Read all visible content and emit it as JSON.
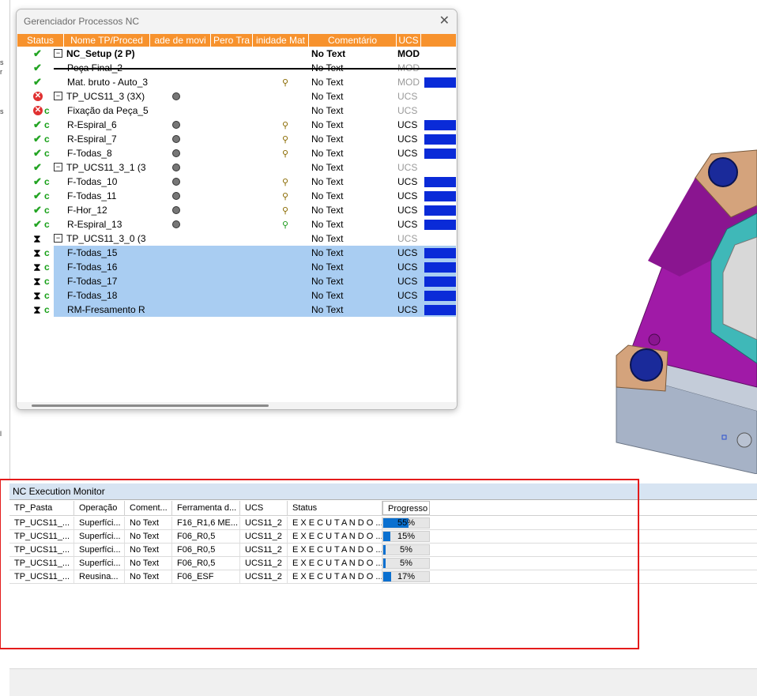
{
  "left_strip_fragments": [
    "s",
    "r",
    "s",
    "l"
  ],
  "nc_manager": {
    "title": "Gerenciador Processos NC",
    "close_label": "✕",
    "columns": [
      "Status",
      "Nome TP/Proced",
      "ade de movi",
      "Pero Tra",
      "inidade Mat",
      "Comentário",
      "UCS"
    ],
    "rows": [
      {
        "status": "setup",
        "c": false,
        "expand": true,
        "name": "NC_Setup (2 P)",
        "bold": true,
        "bulb": false,
        "mat": "",
        "comment": "No Text",
        "ucs": "MOD",
        "ucs_style": "bold",
        "bar": false,
        "sel": false,
        "indent": 0
      },
      {
        "status": "check",
        "c": false,
        "expand": false,
        "name": "Peça Final_2",
        "bold": false,
        "bulb": false,
        "mat": "",
        "comment": "No Text",
        "ucs": "MOD",
        "ucs_style": "gray",
        "bar": false,
        "sel": false,
        "indent": 1
      },
      {
        "status": "check",
        "c": false,
        "expand": false,
        "name": "Mat. bruto - Auto_3",
        "bold": false,
        "bulb": false,
        "mat": "normal",
        "comment": "No Text",
        "ucs": "MOD",
        "ucs_style": "gray",
        "bar": true,
        "sel": false,
        "indent": 1
      },
      {
        "status": "err",
        "c": false,
        "expand": true,
        "name": "TP_UCS11_3 (3X)",
        "bold": false,
        "bulb": true,
        "mat": "",
        "comment": "No Text",
        "ucs": "UCS",
        "ucs_style": "gray",
        "bar": false,
        "sel": false,
        "indent": 0
      },
      {
        "status": "err",
        "c": true,
        "expand": false,
        "name": "Fixação da Peça_5",
        "bold": false,
        "bulb": false,
        "mat": "",
        "comment": "No Text",
        "ucs": "UCS",
        "ucs_style": "gray",
        "bar": false,
        "sel": false,
        "indent": 1
      },
      {
        "status": "check",
        "c": true,
        "expand": false,
        "name": "R-Espiral_6",
        "bold": false,
        "bulb": true,
        "mat": "normal",
        "comment": "No Text",
        "ucs": "UCS",
        "ucs_style": "",
        "bar": true,
        "sel": false,
        "indent": 1
      },
      {
        "status": "check",
        "c": true,
        "expand": false,
        "name": "R-Espiral_7",
        "bold": false,
        "bulb": true,
        "mat": "normal",
        "comment": "No Text",
        "ucs": "UCS",
        "ucs_style": "",
        "bar": true,
        "sel": false,
        "indent": 1
      },
      {
        "status": "check",
        "c": true,
        "expand": false,
        "name": "F-Todas_8",
        "bold": false,
        "bulb": true,
        "mat": "normal",
        "comment": "No Text",
        "ucs": "UCS",
        "ucs_style": "",
        "bar": true,
        "sel": false,
        "indent": 1
      },
      {
        "status": "check",
        "c": false,
        "expand": true,
        "name": "TP_UCS11_3_1 (3",
        "bold": false,
        "bulb": true,
        "mat": "",
        "comment": "No Text",
        "ucs": "UCS",
        "ucs_style": "gray",
        "bar": false,
        "sel": false,
        "indent": 0
      },
      {
        "status": "check",
        "c": true,
        "expand": false,
        "name": "F-Todas_10",
        "bold": false,
        "bulb": true,
        "mat": "normal",
        "comment": "No Text",
        "ucs": "UCS",
        "ucs_style": "",
        "bar": true,
        "sel": false,
        "indent": 1
      },
      {
        "status": "check",
        "c": true,
        "expand": false,
        "name": "F-Todas_11",
        "bold": false,
        "bulb": true,
        "mat": "normal",
        "comment": "No Text",
        "ucs": "UCS",
        "ucs_style": "",
        "bar": true,
        "sel": false,
        "indent": 1
      },
      {
        "status": "check",
        "c": true,
        "expand": false,
        "name": "F-Hor_12",
        "bold": false,
        "bulb": true,
        "mat": "normal",
        "comment": "No Text",
        "ucs": "UCS",
        "ucs_style": "",
        "bar": true,
        "sel": false,
        "indent": 1
      },
      {
        "status": "check",
        "c": true,
        "expand": false,
        "name": "R-Espiral_13",
        "bold": false,
        "bulb": true,
        "mat": "green",
        "comment": "No Text",
        "ucs": "UCS",
        "ucs_style": "",
        "bar": true,
        "sel": false,
        "indent": 1
      },
      {
        "status": "hour",
        "c": false,
        "expand": true,
        "name": "TP_UCS11_3_0 (3",
        "bold": false,
        "bulb": false,
        "mat": "",
        "comment": "No Text",
        "ucs": "UCS",
        "ucs_style": "gray",
        "bar": false,
        "sel": false,
        "indent": 0
      },
      {
        "status": "hour",
        "c": true,
        "expand": false,
        "name": "F-Todas_15",
        "bold": false,
        "bulb": false,
        "mat": "",
        "comment": "No Text",
        "ucs": "UCS",
        "ucs_style": "",
        "bar": true,
        "sel": true,
        "indent": 1
      },
      {
        "status": "hour",
        "c": true,
        "expand": false,
        "name": "F-Todas_16",
        "bold": false,
        "bulb": false,
        "mat": "",
        "comment": "No Text",
        "ucs": "UCS",
        "ucs_style": "",
        "bar": true,
        "sel": true,
        "indent": 1
      },
      {
        "status": "hour",
        "c": true,
        "expand": false,
        "name": "F-Todas_17",
        "bold": false,
        "bulb": false,
        "mat": "",
        "comment": "No Text",
        "ucs": "UCS",
        "ucs_style": "",
        "bar": true,
        "sel": true,
        "indent": 1
      },
      {
        "status": "hour",
        "c": true,
        "expand": false,
        "name": "F-Todas_18",
        "bold": false,
        "bulb": false,
        "mat": "",
        "comment": "No Text",
        "ucs": "UCS",
        "ucs_style": "",
        "bar": true,
        "sel": true,
        "indent": 1
      },
      {
        "status": "hour",
        "c": true,
        "expand": false,
        "name": "RM-Fresamento R",
        "bold": false,
        "bulb": false,
        "mat": "",
        "comment": "No Text",
        "ucs": "UCS",
        "ucs_style": "",
        "bar": true,
        "sel": true,
        "indent": 1
      }
    ]
  },
  "monitor": {
    "title": "NC Execution Monitor",
    "columns": [
      "TP_Pasta",
      "Operação",
      "Coment...",
      "Ferramenta d...",
      "UCS",
      "Status",
      "Progresso"
    ],
    "rows": [
      {
        "pasta": "TP_UCS11_...",
        "operacao": "Superfíci...",
        "comentario": "No Text",
        "ferramenta": "F16_R1,6 ME...",
        "ucs": "UCS11_2",
        "status": "E X E C U T A N D O ...",
        "progress": 55
      },
      {
        "pasta": "TP_UCS11_...",
        "operacao": "Superfíci...",
        "comentario": "No Text",
        "ferramenta": "F06_R0,5",
        "ucs": "UCS11_2",
        "status": "E X E C U T A N D O ...",
        "progress": 15
      },
      {
        "pasta": "TP_UCS11_...",
        "operacao": "Superfíci...",
        "comentario": "No Text",
        "ferramenta": "F06_R0,5",
        "ucs": "UCS11_2",
        "status": "E X E C U T A N D O ...",
        "progress": 5
      },
      {
        "pasta": "TP_UCS11_...",
        "operacao": "Superfíci...",
        "comentario": "No Text",
        "ferramenta": "F06_R0,5",
        "ucs": "UCS11_2",
        "status": "E X E C U T A N D O ...",
        "progress": 5
      },
      {
        "pasta": "TP_UCS11_...",
        "operacao": "Reusina...",
        "comentario": "No Text",
        "ferramenta": "F06_ESF",
        "ucs": "UCS11_2",
        "status": "E X E C U T A N D O ...",
        "progress": 17
      }
    ]
  }
}
